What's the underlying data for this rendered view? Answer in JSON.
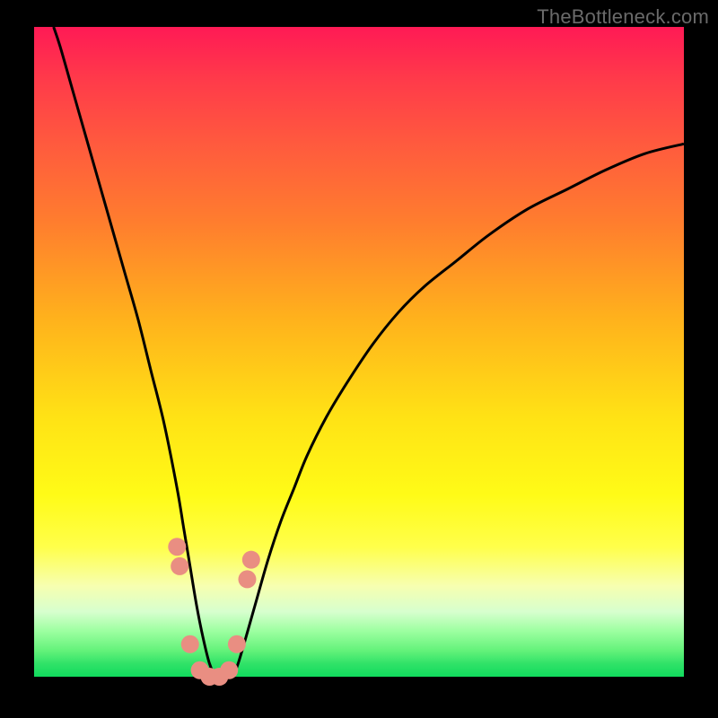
{
  "watermark": "TheBottleneck.com",
  "chart_data": {
    "type": "line",
    "title": "",
    "xlabel": "",
    "ylabel": "",
    "xlim": [
      0,
      100
    ],
    "ylim": [
      0,
      100
    ],
    "series": [
      {
        "name": "curve",
        "x": [
          3,
          4,
          6,
          8,
          10,
          12,
          14,
          16,
          18,
          20,
          22,
          23,
          24,
          25,
          26,
          27,
          28,
          29,
          30,
          31,
          32,
          34,
          36,
          38,
          40,
          42,
          45,
          48,
          52,
          56,
          60,
          65,
          70,
          76,
          82,
          88,
          94,
          100
        ],
        "y": [
          100,
          97,
          90,
          83,
          76,
          69,
          62,
          55,
          47,
          39,
          29,
          23,
          17,
          11,
          6,
          2,
          0,
          0,
          0,
          1,
          4,
          11,
          18,
          24,
          29,
          34,
          40,
          45,
          51,
          56,
          60,
          64,
          68,
          72,
          75,
          78,
          80.5,
          82
        ]
      }
    ],
    "markers": {
      "note": "salmon dots near the trough",
      "color": "#e98e82",
      "points": [
        {
          "x": 22.0,
          "y": 20
        },
        {
          "x": 22.4,
          "y": 17
        },
        {
          "x": 24.0,
          "y": 5
        },
        {
          "x": 25.5,
          "y": 1
        },
        {
          "x": 27.0,
          "y": 0
        },
        {
          "x": 28.5,
          "y": 0
        },
        {
          "x": 30.0,
          "y": 1
        },
        {
          "x": 31.2,
          "y": 5
        },
        {
          "x": 32.8,
          "y": 15
        },
        {
          "x": 33.4,
          "y": 18
        }
      ]
    }
  }
}
